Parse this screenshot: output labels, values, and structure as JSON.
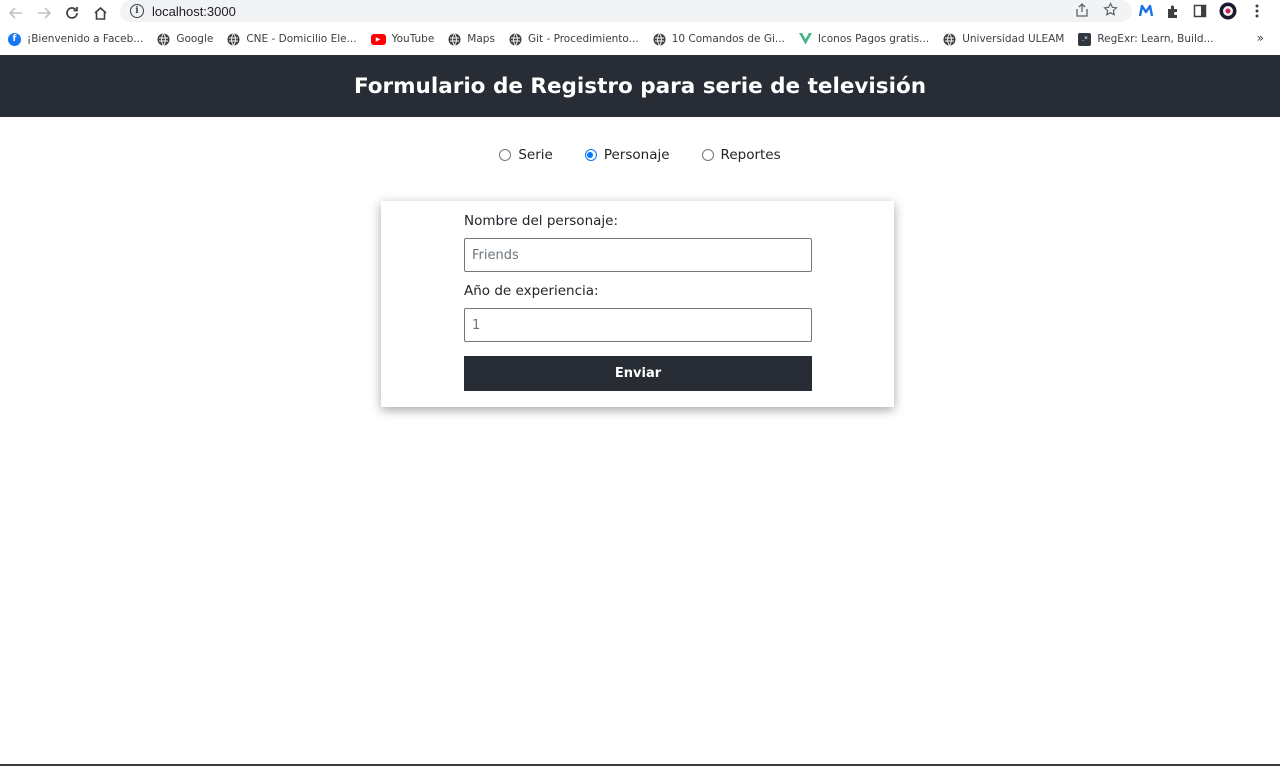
{
  "browser": {
    "url": "localhost:3000",
    "bookmarks": [
      {
        "label": "¡Bienvenido a Faceb...",
        "icon": "facebook-icon",
        "color": "#1877f2"
      },
      {
        "label": "Google",
        "icon": "globe-icon",
        "color": "#3c4043"
      },
      {
        "label": "CNE - Domicilio Ele...",
        "icon": "globe-icon",
        "color": "#3c4043"
      },
      {
        "label": "YouTube",
        "icon": "youtube-icon",
        "color": "#ff0000"
      },
      {
        "label": "Maps",
        "icon": "globe-icon",
        "color": "#3c4043"
      },
      {
        "label": "Git - Procedimiento...",
        "icon": "globe-icon",
        "color": "#3c4043"
      },
      {
        "label": "10 Comandos de Gi...",
        "icon": "globe-icon",
        "color": "#3c4043"
      },
      {
        "label": "Iconos Pagos gratis...",
        "icon": "vue-icon",
        "color": "#41b883"
      },
      {
        "label": "Universidad ULEAM",
        "icon": "globe-icon",
        "color": "#3c4043"
      },
      {
        "label": "RegExr: Learn, Build...",
        "icon": "regexr-icon",
        "color": "#2f3740"
      }
    ],
    "more_bookmarks": "»"
  },
  "header": {
    "title": "Formulario de Registro para serie de televisión"
  },
  "radios": [
    {
      "label": "Serie",
      "checked": false
    },
    {
      "label": "Personaje",
      "checked": true
    },
    {
      "label": "Reportes",
      "checked": false
    }
  ],
  "form": {
    "name_label": "Nombre del personaje:",
    "name_placeholder": "Friends",
    "years_label": "Año de experiencia:",
    "years_placeholder": "1",
    "submit_label": "Enviar"
  },
  "colors": {
    "header_bg": "#282c34",
    "button_bg": "#282c34",
    "radio_accent": "#0075ff"
  }
}
